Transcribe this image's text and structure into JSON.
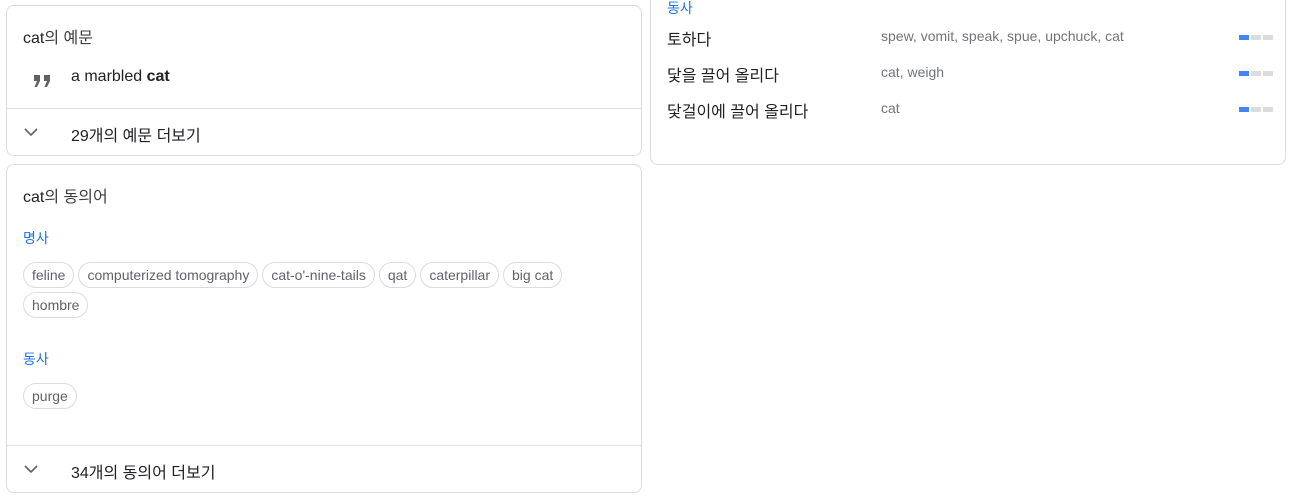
{
  "examples": {
    "title_word": "cat",
    "title_suffix": "의 예문",
    "items": [
      {
        "before": "a marbled ",
        "bold": "cat"
      }
    ],
    "more_label": "29개의 예문 더보기"
  },
  "synonyms": {
    "title_word": "cat",
    "title_suffix": "의 동의어",
    "groups": [
      {
        "pos": "명사",
        "chips": [
          "feline",
          "computerized tomography",
          "cat-o'-nine-tails",
          "qat",
          "caterpillar",
          "big cat",
          "hombre"
        ]
      },
      {
        "pos": "동사",
        "chips": [
          "purge"
        ]
      }
    ],
    "more_label": "34개의 동의어 더보기"
  },
  "translations": {
    "pos": "동사",
    "rows": [
      {
        "word": "토하다",
        "synonyms": "spew, vomit, speak, spue, upchuck, cat",
        "frequency": 1
      },
      {
        "word": "닻을 끌어 올리다",
        "synonyms": "cat, weigh",
        "frequency": 1
      },
      {
        "word": "닻걸이에 끌어 올리다",
        "synonyms": "cat",
        "frequency": 1
      }
    ],
    "frequency_max": 3
  },
  "colors": {
    "accent": "#1a73e8",
    "frequency_on": "#4285f4",
    "frequency_off": "#dadce0",
    "border": "#dadce0"
  }
}
